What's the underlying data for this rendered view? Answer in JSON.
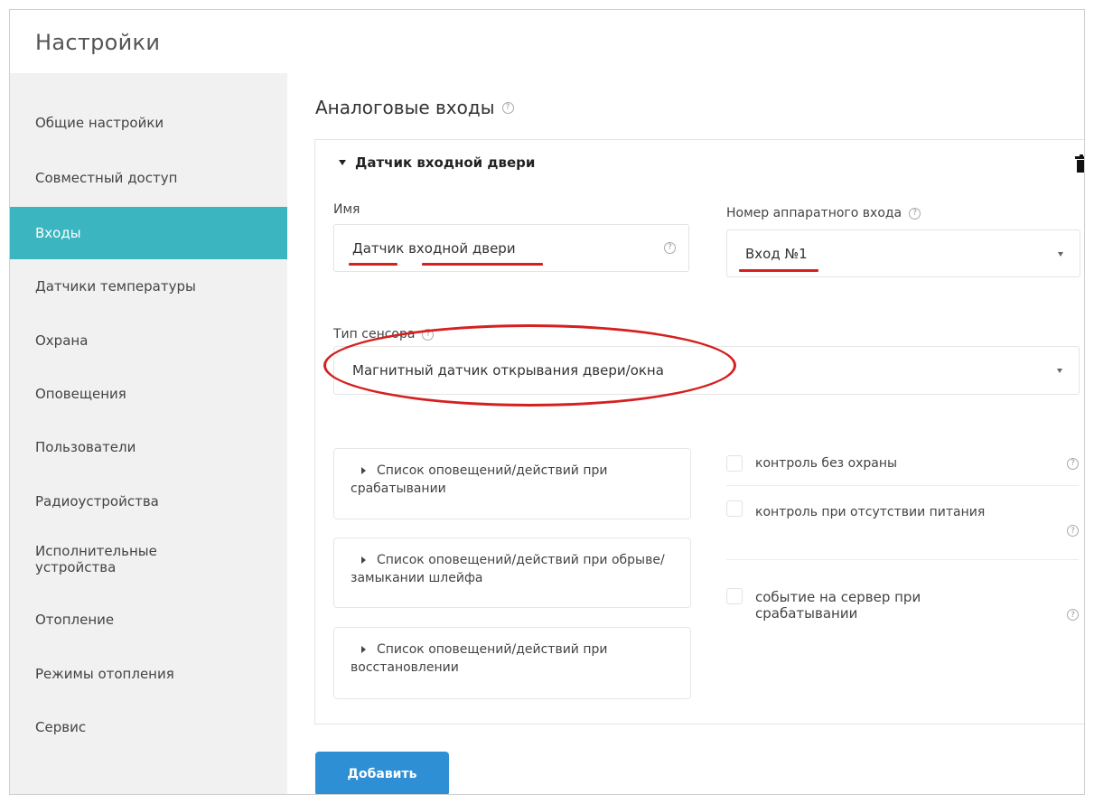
{
  "header": {
    "title": "Настройки"
  },
  "sidebar": {
    "items": [
      {
        "label": "Общие настройки"
      },
      {
        "label": "Совместный доступ"
      },
      {
        "label": "Входы",
        "active": true
      },
      {
        "label": "Датчики температуры"
      },
      {
        "label": "Охрана"
      },
      {
        "label": "Оповещения"
      },
      {
        "label": "Пользователи"
      },
      {
        "label": "Радиоустройства"
      },
      {
        "label": "Исполнительные устройства"
      },
      {
        "label": "Отопление"
      },
      {
        "label": "Режимы отопления"
      },
      {
        "label": "Сервис"
      }
    ]
  },
  "main": {
    "section_title": "Аналоговые входы",
    "card": {
      "title": "Датчик входной двери",
      "name_label": "Имя",
      "name_value": "Датчик входной двери",
      "hw_input_label": "Номер аппаратного входа",
      "hw_input_value": "Вход №1",
      "sensor_type_label": "Тип сенсора",
      "sensor_type_value": "Магнитный датчик открывания двери/окна",
      "panels": [
        {
          "label": "Список оповещений/действий при срабатывании"
        },
        {
          "label": "Список оповещений/действий при обрыве/замыкании шлейфа"
        },
        {
          "label": "Список оповещений/действий при восстановлении"
        }
      ],
      "checkboxes": [
        {
          "label": "контроль без охраны",
          "checked": false
        },
        {
          "label": "контроль при отсутствии питания",
          "checked": false
        },
        {
          "label": "событие на сервер при срабатывании",
          "checked": false
        }
      ]
    },
    "add_button": "Добавить"
  },
  "help_glyph": "?",
  "colors": {
    "accent": "#3bb5c0",
    "button": "#2f8fd5",
    "annotation": "#d61f1f"
  }
}
